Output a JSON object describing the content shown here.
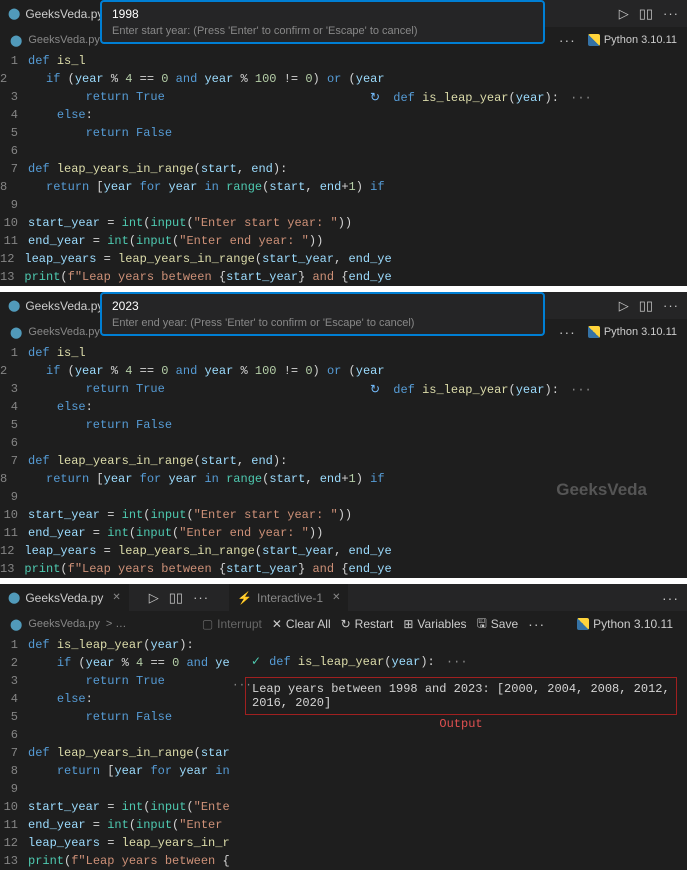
{
  "filename": "GeeksVeda.py",
  "python_version": "Python 3.10.11",
  "interactive_tab": "Interactive-1",
  "breadcrumb_suffix": "> …",
  "prompt_start": {
    "value": "1998",
    "hint": "Enter start year: (Press 'Enter' to confirm or 'Escape' to cancel)"
  },
  "prompt_end": {
    "value": "2023",
    "hint": "Enter end year: (Press 'Enter' to confirm or 'Escape' to cancel)"
  },
  "toolbar": {
    "interrupt": "Interrupt",
    "clear": "Clear All",
    "restart": "Restart",
    "variables": "Variables",
    "save": "Save",
    "more": "···"
  },
  "signature": "def is_leap_year(year):",
  "output_text": "Leap years between 1998 and 2023: [2000, 2004, 2008, 2012, 2016, 2020]",
  "output_label": "Output",
  "watermark": "GeeksVeda",
  "code": {
    "l1": "def is_leap_year(year):",
    "l1t": "def is_l",
    "l2": "    if (year % 4 == 0 and year % 100 != 0) or (year",
    "l2n": "    if (year % 4 == 0 and ye",
    "l3": "        return True",
    "l4": "    else:",
    "l5": "        return False",
    "l7": "def leap_years_in_range(start, end):",
    "l7n": "def leap_years_in_range(star",
    "l8": "    return [year for year in range(start, end+1) if",
    "l8n": "    return [year for year in",
    "l10": "start_year = int(input(\"Enter start year: \"))",
    "l10n": "start_year = int(input(\"Ente",
    "l11": "end_year = int(input(\"Enter end year: \"))",
    "l11n": "end_year = int(input(\"Enter",
    "l12": "leap_years = leap_years_in_range(start_year, end_ye",
    "l12n": "leap_years = leap_years_in_r",
    "l13": "print(f\"Leap years between {start_year} and {end_ye",
    "l13n": "print(f\"Leap years between {"
  }
}
